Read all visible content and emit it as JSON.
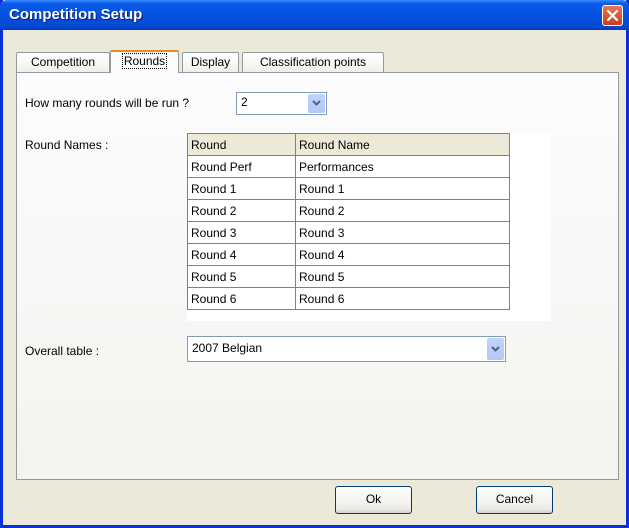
{
  "window": {
    "title": "Competition Setup"
  },
  "tabs": [
    {
      "label": "Competition"
    },
    {
      "label": "Rounds"
    },
    {
      "label": "Display"
    },
    {
      "label": "Classification points"
    }
  ],
  "rounds_question": {
    "label": "How many rounds will be run ?",
    "value": "2"
  },
  "round_names": {
    "label": "Round Names :",
    "columns": [
      "Round",
      "Round Name"
    ],
    "rows": [
      [
        "Round Perf",
        "Performances"
      ],
      [
        "Round 1",
        "Round 1"
      ],
      [
        "Round 2",
        "Round 2"
      ],
      [
        "Round 3",
        "Round 3"
      ],
      [
        "Round 4",
        "Round 4"
      ],
      [
        "Round 5",
        "Round 5"
      ],
      [
        "Round 6",
        "Round 6"
      ]
    ]
  },
  "overall_table": {
    "label": "Overall table :",
    "value": "2007 Belgian"
  },
  "buttons": {
    "ok": "Ok",
    "cancel": "Cancel"
  },
  "icons": {
    "close": "close-icon",
    "dropdown": "chevron-down-icon"
  }
}
